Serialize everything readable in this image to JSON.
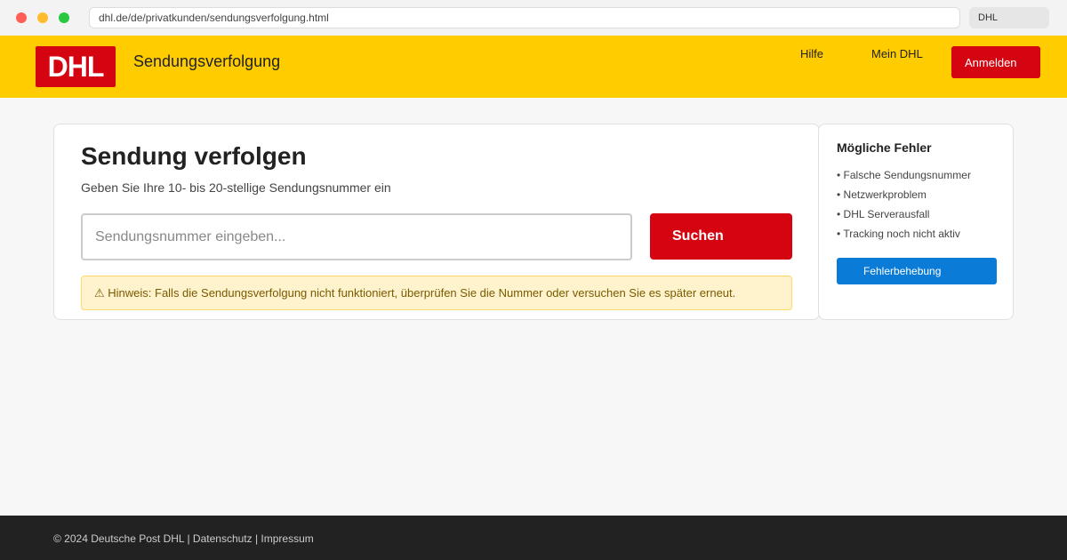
{
  "browser": {
    "url": "dhl.de/de/privatkunden/sendungsverfolgung.html",
    "tab_label": "DHL"
  },
  "colors": {
    "brand_yellow": "#ffcc00",
    "brand_red": "#d40511",
    "action_blue": "#0a7bd6",
    "notice_bg": "#fff3cd"
  },
  "header": {
    "logo_text": "DHL",
    "title": "Sendungsverfolgung",
    "nav": {
      "help": "Hilfe",
      "my_dhl": "Mein DHL"
    },
    "login_label": "Anmelden"
  },
  "main": {
    "title": "Sendung verfolgen",
    "subtitle": "Geben Sie Ihre 10- bis 20-stellige Sendungsnummer ein",
    "input": {
      "value": "",
      "placeholder": "Sendungsnummer eingeben..."
    },
    "search_label": "Suchen",
    "notice": "⚠ Hinweis: Falls die Sendungsverfolgung nicht funktioniert, überprüfen Sie die Nummer oder versuchen Sie es später erneut."
  },
  "sidebar": {
    "title": "Mögliche Fehler",
    "items": [
      "• Falsche Sendungsnummer",
      "• Netzwerkproblem",
      "• DHL Serverausfall",
      "• Tracking noch nicht aktiv"
    ],
    "button_label": "Fehlerbehebung"
  },
  "footer": {
    "text": "© 2024 Deutsche Post DHL | Datenschutz | Impressum"
  }
}
